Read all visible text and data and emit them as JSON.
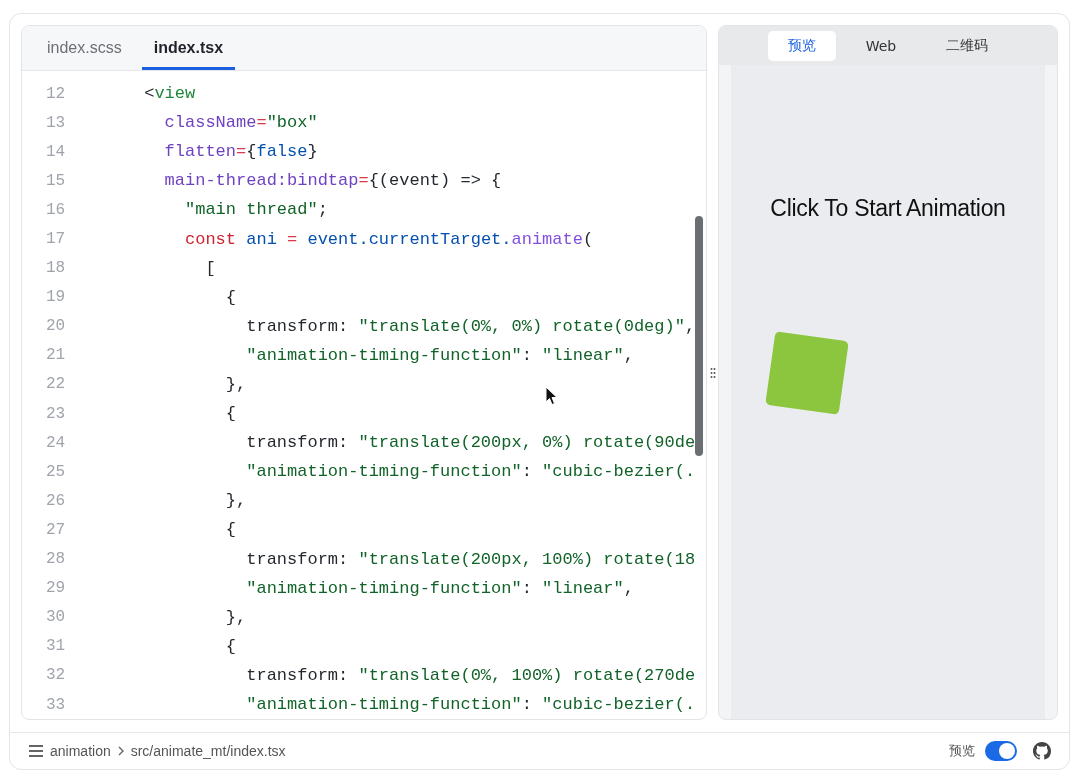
{
  "editor": {
    "tabs": [
      {
        "label": "index.scss",
        "selected": false
      },
      {
        "label": "index.tsx",
        "selected": true
      }
    ],
    "lines": [
      {
        "n": "12",
        "tokens": [
          {
            "kind": "p",
            "text": "      <"
          },
          {
            "kind": "tag",
            "text": "view"
          }
        ]
      },
      {
        "n": "13",
        "tokens": [
          {
            "kind": "attr",
            "text": "        className"
          },
          {
            "kind": "op",
            "text": "="
          },
          {
            "kind": "str",
            "text": "\"box\""
          }
        ]
      },
      {
        "n": "14",
        "tokens": [
          {
            "kind": "attr",
            "text": "        flatten"
          },
          {
            "kind": "op",
            "text": "="
          },
          {
            "kind": "p",
            "text": "{"
          },
          {
            "kind": "bool",
            "text": "false"
          },
          {
            "kind": "p",
            "text": "}"
          }
        ]
      },
      {
        "n": "15",
        "tokens": [
          {
            "kind": "attr",
            "text": "        main-thread:bindtap"
          },
          {
            "kind": "op",
            "text": "="
          },
          {
            "kind": "p",
            "text": "{(event) => {"
          }
        ]
      },
      {
        "n": "16",
        "tokens": [
          {
            "kind": "str",
            "text": "          \"main thread\""
          },
          {
            "kind": "p",
            "text": ";"
          }
        ]
      },
      {
        "n": "17",
        "tokens": [
          {
            "kind": "kw",
            "text": "          const"
          },
          {
            "kind": "var",
            "text": " ani"
          },
          {
            "kind": "op",
            "text": " ="
          },
          {
            "kind": "var",
            "text": " event.currentTarget."
          },
          {
            "kind": "fn",
            "text": "animate"
          },
          {
            "kind": "p",
            "text": "("
          }
        ]
      },
      {
        "n": "18",
        "tokens": [
          {
            "kind": "p",
            "text": "            ["
          }
        ]
      },
      {
        "n": "19",
        "tokens": [
          {
            "kind": "p",
            "text": "              {"
          }
        ]
      },
      {
        "n": "20",
        "tokens": [
          {
            "kind": "prop",
            "text": "                transform:"
          },
          {
            "kind": "str",
            "text": " \"translate(0%, 0%) rotate(0deg)\""
          },
          {
            "kind": "p",
            "text": ","
          }
        ]
      },
      {
        "n": "21",
        "tokens": [
          {
            "kind": "str",
            "text": "                \"animation-timing-function\""
          },
          {
            "kind": "p",
            "text": ": "
          },
          {
            "kind": "str",
            "text": "\"linear\""
          },
          {
            "kind": "p",
            "text": ","
          }
        ]
      },
      {
        "n": "22",
        "tokens": [
          {
            "kind": "p",
            "text": "              },"
          }
        ]
      },
      {
        "n": "23",
        "tokens": [
          {
            "kind": "p",
            "text": "              {"
          }
        ]
      },
      {
        "n": "24",
        "tokens": [
          {
            "kind": "prop",
            "text": "                transform:"
          },
          {
            "kind": "str",
            "text": " \"translate(200px, 0%) rotate(90de"
          }
        ]
      },
      {
        "n": "25",
        "tokens": [
          {
            "kind": "str",
            "text": "                \"animation-timing-function\""
          },
          {
            "kind": "p",
            "text": ": "
          },
          {
            "kind": "str",
            "text": "\"cubic-bezier(."
          }
        ]
      },
      {
        "n": "26",
        "tokens": [
          {
            "kind": "p",
            "text": "              },"
          }
        ]
      },
      {
        "n": "27",
        "tokens": [
          {
            "kind": "p",
            "text": "              {"
          }
        ]
      },
      {
        "n": "28",
        "tokens": [
          {
            "kind": "prop",
            "text": "                transform:"
          },
          {
            "kind": "str",
            "text": " \"translate(200px, 100%) rotate(18"
          }
        ]
      },
      {
        "n": "29",
        "tokens": [
          {
            "kind": "str",
            "text": "                \"animation-timing-function\""
          },
          {
            "kind": "p",
            "text": ": "
          },
          {
            "kind": "str",
            "text": "\"linear\""
          },
          {
            "kind": "p",
            "text": ","
          }
        ]
      },
      {
        "n": "30",
        "tokens": [
          {
            "kind": "p",
            "text": "              },"
          }
        ]
      },
      {
        "n": "31",
        "tokens": [
          {
            "kind": "p",
            "text": "              {"
          }
        ]
      },
      {
        "n": "32",
        "tokens": [
          {
            "kind": "prop",
            "text": "                transform:"
          },
          {
            "kind": "str",
            "text": " \"translate(0%, 100%) rotate(270de"
          }
        ]
      },
      {
        "n": "33",
        "tokens": [
          {
            "kind": "str",
            "text": "                \"animation-timing-function\""
          },
          {
            "kind": "p",
            "text": ": "
          },
          {
            "kind": "str",
            "text": "\"cubic-bezier(."
          }
        ]
      }
    ]
  },
  "preview": {
    "tabs": [
      {
        "label": "预览",
        "selected": true
      },
      {
        "label": "Web",
        "selected": false
      },
      {
        "label": "二维码",
        "selected": false
      }
    ],
    "heading": "Click To Start Animation"
  },
  "status_bar": {
    "breadcrumb": [
      "animation",
      "src/animate_mt/index.tsx"
    ],
    "toggle": {
      "label": "预览",
      "on": true
    }
  }
}
